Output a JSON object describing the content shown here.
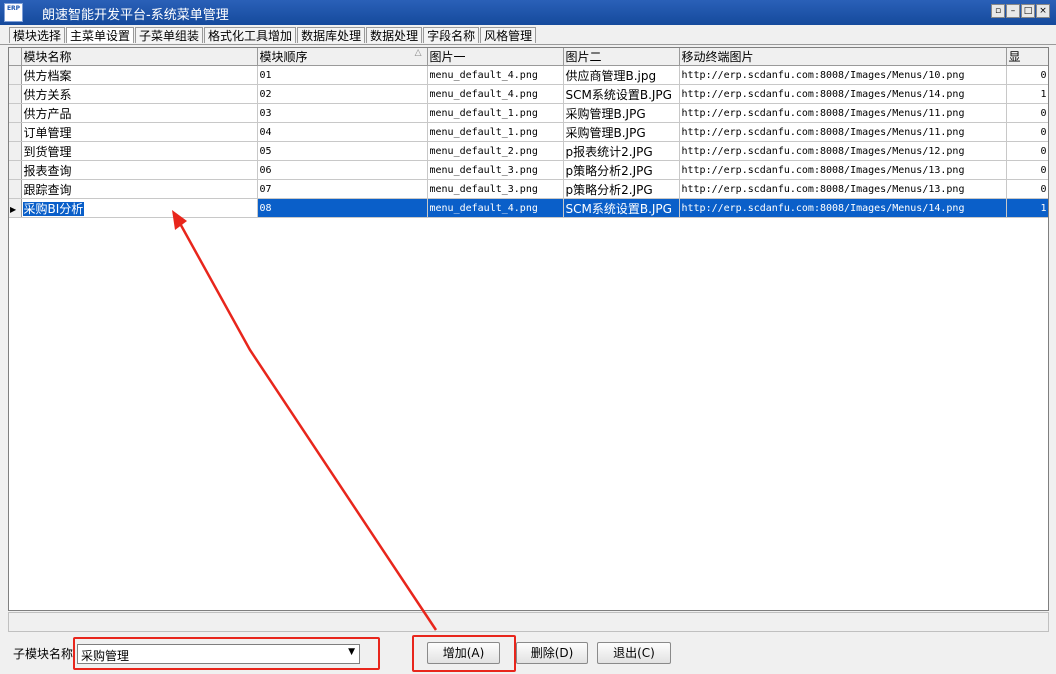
{
  "window": {
    "logo_text": "ERP",
    "title": "朗速智能开发平台-系统菜单管理"
  },
  "tabs": [
    {
      "label": "模块选择"
    },
    {
      "label": "主菜单设置"
    },
    {
      "label": "子菜单组装"
    },
    {
      "label": "格式化工具增加"
    },
    {
      "label": "数据库处理"
    },
    {
      "label": "数据处理"
    },
    {
      "label": "字段名称"
    },
    {
      "label": "风格管理"
    }
  ],
  "grid": {
    "columns": [
      "模块名称",
      "模块顺序",
      "图片一",
      "图片二",
      "移动终端图片",
      "显"
    ],
    "rows": [
      {
        "name": "供方档案",
        "order": "01",
        "img1": "menu_default_4.png",
        "img2": "供应商管理B.jpg",
        "mobile": "http://erp.scdanfu.com:8008/Images/Menus/10.png",
        "show": "0"
      },
      {
        "name": "供方关系",
        "order": "02",
        "img1": "menu_default_4.png",
        "img2": "SCM系统设置B.JPG",
        "mobile": "http://erp.scdanfu.com:8008/Images/Menus/14.png",
        "show": "1"
      },
      {
        "name": "供方产品",
        "order": "03",
        "img1": "menu_default_1.png",
        "img2": "采购管理B.JPG",
        "mobile": "http://erp.scdanfu.com:8008/Images/Menus/11.png",
        "show": "0"
      },
      {
        "name": "订单管理",
        "order": "04",
        "img1": "menu_default_1.png",
        "img2": "采购管理B.JPG",
        "mobile": "http://erp.scdanfu.com:8008/Images/Menus/11.png",
        "show": "0"
      },
      {
        "name": "到货管理",
        "order": "05",
        "img1": "menu_default_2.png",
        "img2": "p报表统计2.JPG",
        "mobile": "http://erp.scdanfu.com:8008/Images/Menus/12.png",
        "show": "0"
      },
      {
        "name": "报表查询",
        "order": "06",
        "img1": "menu_default_3.png",
        "img2": "p策略分析2.JPG",
        "mobile": "http://erp.scdanfu.com:8008/Images/Menus/13.png",
        "show": "0"
      },
      {
        "name": "跟踪查询",
        "order": "07",
        "img1": "menu_default_3.png",
        "img2": "p策略分析2.JPG",
        "mobile": "http://erp.scdanfu.com:8008/Images/Menus/13.png",
        "show": "0"
      },
      {
        "name": "采购BI分析",
        "order": "08",
        "img1": "menu_default_4.png",
        "img2": "SCM系统设置B.JPG",
        "mobile": "http://erp.scdanfu.com:8008/Images/Menus/14.png",
        "show": "1"
      }
    ],
    "selected_row": 7
  },
  "bottom": {
    "sub_module_label": "子模块名称",
    "sub_module_value": "采购管理",
    "add_label": "增加(A)",
    "delete_label": "删除(D)",
    "exit_label": "退出(C)"
  },
  "colors": {
    "title_bar": "#1c56b0",
    "selection": "#0a5fc9",
    "annotation": "#e8261c"
  },
  "icons": [
    "erp-logo-icon",
    "sort-triangle-icon",
    "row-pointer-icon",
    "dropdown-arrow-icon"
  ]
}
